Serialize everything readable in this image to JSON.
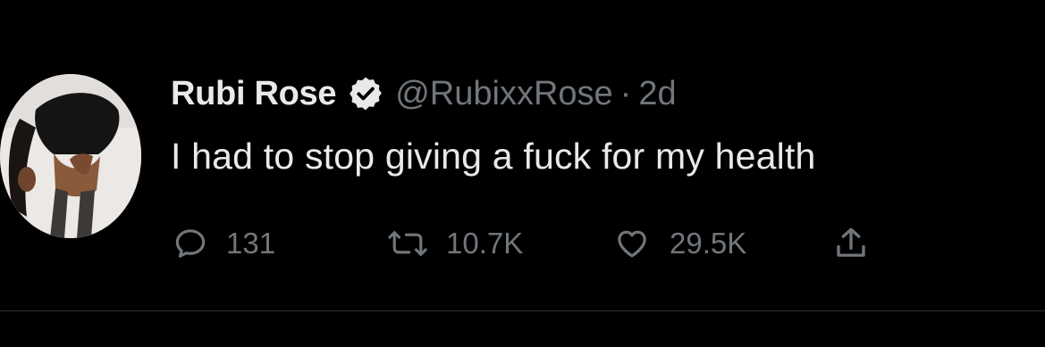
{
  "tweet": {
    "author": {
      "name": "Rubi Rose",
      "handle": "@RubixxRose",
      "verified": true,
      "avatar_icon": "profile-photo"
    },
    "separator": "·",
    "time": "2d",
    "text": "I had to stop giving a fuck for my health",
    "actions": {
      "reply": {
        "icon": "reply-icon",
        "count": "131"
      },
      "retweet": {
        "icon": "retweet-icon",
        "count": "10.7K"
      },
      "like": {
        "icon": "heart-icon",
        "count": "29.5K"
      },
      "share": {
        "icon": "share-icon"
      }
    }
  },
  "colors": {
    "background": "#000000",
    "primary_text": "#e7e9ea",
    "secondary_text": "#71767b",
    "divider": "#2f3336"
  }
}
